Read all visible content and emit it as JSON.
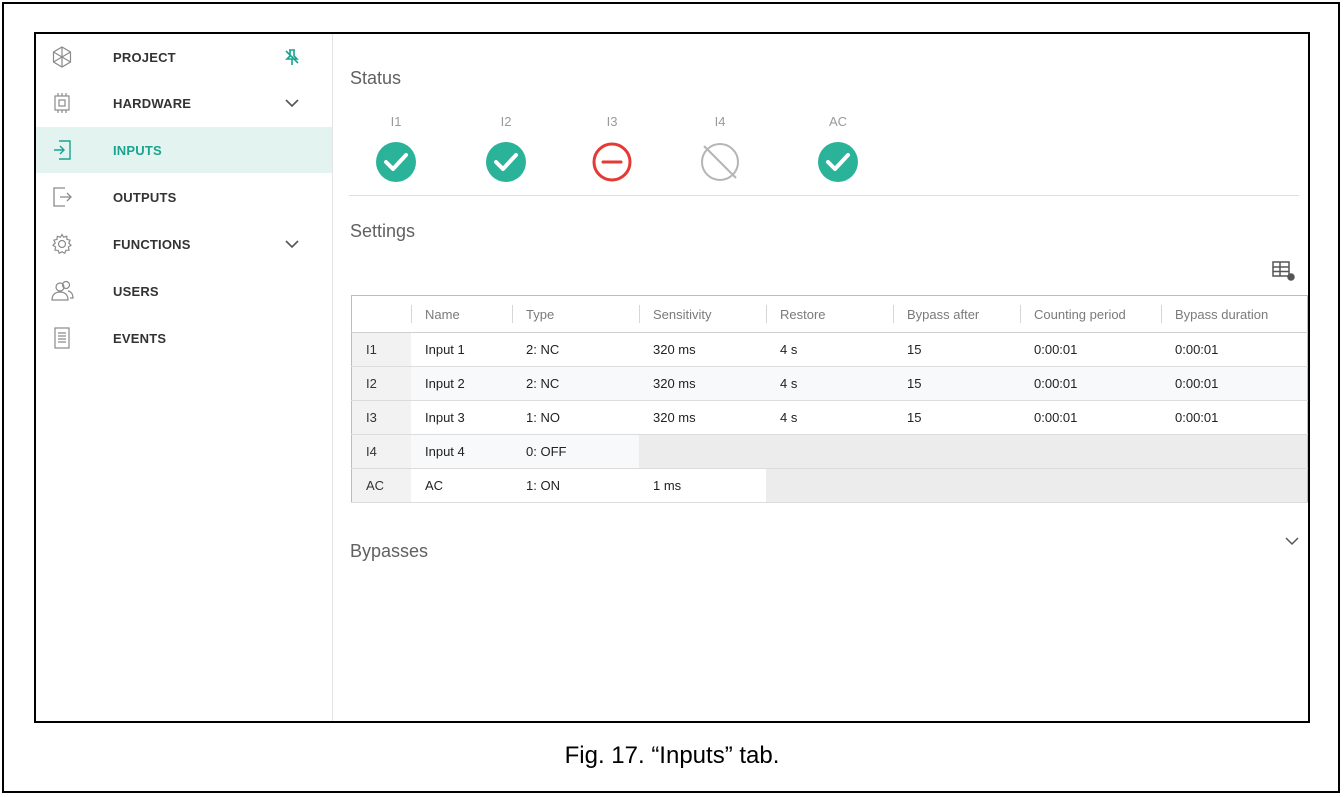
{
  "sidebar": {
    "items": [
      {
        "label": "PROJECT",
        "icon": "project-icon",
        "right_icon": "pin-icon",
        "active": false
      },
      {
        "label": "HARDWARE",
        "icon": "hardware-chip-icon",
        "right_icon": "chevron-down-icon",
        "active": false
      },
      {
        "label": "INPUTS",
        "icon": "input-icon",
        "active": true
      },
      {
        "label": "OUTPUTS",
        "icon": "output-icon",
        "active": false
      },
      {
        "label": "FUNCTIONS",
        "icon": "gear-icon",
        "right_icon": "chevron-down-icon",
        "active": false
      },
      {
        "label": "USERS",
        "icon": "users-icon",
        "active": false
      },
      {
        "label": "EVENTS",
        "icon": "document-icon",
        "active": false
      }
    ]
  },
  "status": {
    "title": "Status",
    "items": [
      {
        "label": "I1",
        "state": "ok"
      },
      {
        "label": "I2",
        "state": "ok"
      },
      {
        "label": "I3",
        "state": "alarm"
      },
      {
        "label": "I4",
        "state": "disabled"
      },
      {
        "label": "AC",
        "state": "ok"
      }
    ]
  },
  "settings": {
    "title": "Settings",
    "columns": [
      "",
      "Name",
      "Type",
      "Sensitivity",
      "Restore",
      "Bypass after",
      "Counting period",
      "Bypass duration"
    ],
    "rows": [
      {
        "id": "I1",
        "name": "Input 1",
        "type": "2: NC",
        "sensitivity": "320 ms",
        "restore": "4 s",
        "bypass_after": "15",
        "counting_period": "0:00:01",
        "bypass_duration": "0:00:01"
      },
      {
        "id": "I2",
        "name": "Input 2",
        "type": "2: NC",
        "sensitivity": "320 ms",
        "restore": "4 s",
        "bypass_after": "15",
        "counting_period": "0:00:01",
        "bypass_duration": "0:00:01"
      },
      {
        "id": "I3",
        "name": "Input 3",
        "type": "1: NO",
        "sensitivity": "320 ms",
        "restore": "4 s",
        "bypass_after": "15",
        "counting_period": "0:00:01",
        "bypass_duration": "0:00:01"
      },
      {
        "id": "I4",
        "name": "Input 4",
        "type": "0: OFF"
      },
      {
        "id": "AC",
        "name": "AC",
        "type": "1: ON",
        "sensitivity": "1 ms"
      }
    ]
  },
  "bypasses": {
    "title": "Bypasses"
  },
  "caption": "Fig. 17. “Inputs” tab.",
  "colors": {
    "accent": "#1aa38f",
    "ok": "#2bb39a",
    "alarm": "#e53935",
    "disabled": "#b5b5b5"
  }
}
